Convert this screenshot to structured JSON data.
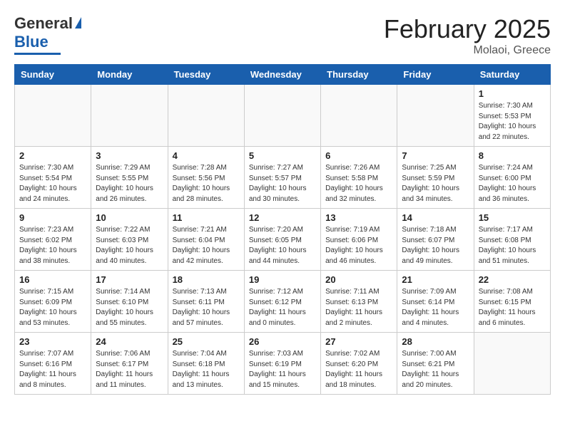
{
  "header": {
    "logo_line1": "General",
    "logo_line2": "Blue",
    "title": "February 2025",
    "subtitle": "Molaoi, Greece"
  },
  "weekdays": [
    "Sunday",
    "Monday",
    "Tuesday",
    "Wednesday",
    "Thursday",
    "Friday",
    "Saturday"
  ],
  "weeks": [
    [
      {
        "day": "",
        "info": ""
      },
      {
        "day": "",
        "info": ""
      },
      {
        "day": "",
        "info": ""
      },
      {
        "day": "",
        "info": ""
      },
      {
        "day": "",
        "info": ""
      },
      {
        "day": "",
        "info": ""
      },
      {
        "day": "1",
        "info": "Sunrise: 7:30 AM\nSunset: 5:53 PM\nDaylight: 10 hours\nand 22 minutes."
      }
    ],
    [
      {
        "day": "2",
        "info": "Sunrise: 7:30 AM\nSunset: 5:54 PM\nDaylight: 10 hours\nand 24 minutes."
      },
      {
        "day": "3",
        "info": "Sunrise: 7:29 AM\nSunset: 5:55 PM\nDaylight: 10 hours\nand 26 minutes."
      },
      {
        "day": "4",
        "info": "Sunrise: 7:28 AM\nSunset: 5:56 PM\nDaylight: 10 hours\nand 28 minutes."
      },
      {
        "day": "5",
        "info": "Sunrise: 7:27 AM\nSunset: 5:57 PM\nDaylight: 10 hours\nand 30 minutes."
      },
      {
        "day": "6",
        "info": "Sunrise: 7:26 AM\nSunset: 5:58 PM\nDaylight: 10 hours\nand 32 minutes."
      },
      {
        "day": "7",
        "info": "Sunrise: 7:25 AM\nSunset: 5:59 PM\nDaylight: 10 hours\nand 34 minutes."
      },
      {
        "day": "8",
        "info": "Sunrise: 7:24 AM\nSunset: 6:00 PM\nDaylight: 10 hours\nand 36 minutes."
      }
    ],
    [
      {
        "day": "9",
        "info": "Sunrise: 7:23 AM\nSunset: 6:02 PM\nDaylight: 10 hours\nand 38 minutes."
      },
      {
        "day": "10",
        "info": "Sunrise: 7:22 AM\nSunset: 6:03 PM\nDaylight: 10 hours\nand 40 minutes."
      },
      {
        "day": "11",
        "info": "Sunrise: 7:21 AM\nSunset: 6:04 PM\nDaylight: 10 hours\nand 42 minutes."
      },
      {
        "day": "12",
        "info": "Sunrise: 7:20 AM\nSunset: 6:05 PM\nDaylight: 10 hours\nand 44 minutes."
      },
      {
        "day": "13",
        "info": "Sunrise: 7:19 AM\nSunset: 6:06 PM\nDaylight: 10 hours\nand 46 minutes."
      },
      {
        "day": "14",
        "info": "Sunrise: 7:18 AM\nSunset: 6:07 PM\nDaylight: 10 hours\nand 49 minutes."
      },
      {
        "day": "15",
        "info": "Sunrise: 7:17 AM\nSunset: 6:08 PM\nDaylight: 10 hours\nand 51 minutes."
      }
    ],
    [
      {
        "day": "16",
        "info": "Sunrise: 7:15 AM\nSunset: 6:09 PM\nDaylight: 10 hours\nand 53 minutes."
      },
      {
        "day": "17",
        "info": "Sunrise: 7:14 AM\nSunset: 6:10 PM\nDaylight: 10 hours\nand 55 minutes."
      },
      {
        "day": "18",
        "info": "Sunrise: 7:13 AM\nSunset: 6:11 PM\nDaylight: 10 hours\nand 57 minutes."
      },
      {
        "day": "19",
        "info": "Sunrise: 7:12 AM\nSunset: 6:12 PM\nDaylight: 11 hours\nand 0 minutes."
      },
      {
        "day": "20",
        "info": "Sunrise: 7:11 AM\nSunset: 6:13 PM\nDaylight: 11 hours\nand 2 minutes."
      },
      {
        "day": "21",
        "info": "Sunrise: 7:09 AM\nSunset: 6:14 PM\nDaylight: 11 hours\nand 4 minutes."
      },
      {
        "day": "22",
        "info": "Sunrise: 7:08 AM\nSunset: 6:15 PM\nDaylight: 11 hours\nand 6 minutes."
      }
    ],
    [
      {
        "day": "23",
        "info": "Sunrise: 7:07 AM\nSunset: 6:16 PM\nDaylight: 11 hours\nand 8 minutes."
      },
      {
        "day": "24",
        "info": "Sunrise: 7:06 AM\nSunset: 6:17 PM\nDaylight: 11 hours\nand 11 minutes."
      },
      {
        "day": "25",
        "info": "Sunrise: 7:04 AM\nSunset: 6:18 PM\nDaylight: 11 hours\nand 13 minutes."
      },
      {
        "day": "26",
        "info": "Sunrise: 7:03 AM\nSunset: 6:19 PM\nDaylight: 11 hours\nand 15 minutes."
      },
      {
        "day": "27",
        "info": "Sunrise: 7:02 AM\nSunset: 6:20 PM\nDaylight: 11 hours\nand 18 minutes."
      },
      {
        "day": "28",
        "info": "Sunrise: 7:00 AM\nSunset: 6:21 PM\nDaylight: 11 hours\nand 20 minutes."
      },
      {
        "day": "",
        "info": ""
      }
    ]
  ]
}
